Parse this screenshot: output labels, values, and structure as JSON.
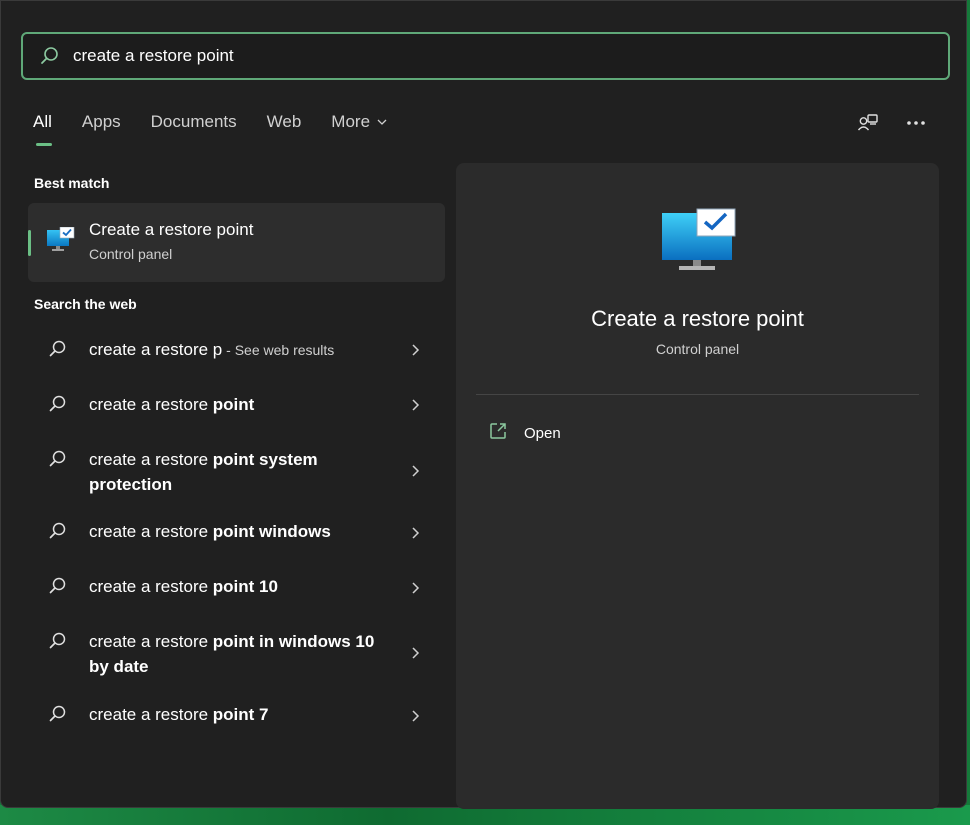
{
  "search": {
    "value": "create a restore point",
    "placeholder": ""
  },
  "tabs": [
    {
      "label": "All"
    },
    {
      "label": "Apps"
    },
    {
      "label": "Documents"
    },
    {
      "label": "Web"
    },
    {
      "label": "More"
    }
  ],
  "best_match": {
    "section": "Best match",
    "title_normal": "Create a restore p",
    "title_bold": "",
    "title": "Create a restore point",
    "subtitle": "Control panel",
    "icon": "monitor-check-icon"
  },
  "web": {
    "section": "Search the web",
    "items": [
      {
        "normal": "create a restore p",
        "bold": "",
        "hint": " - See web results"
      },
      {
        "normal": "create a restore ",
        "bold": "point",
        "hint": ""
      },
      {
        "normal": "create a restore ",
        "bold": "point system protection",
        "hint": ""
      },
      {
        "normal": "create a restore ",
        "bold": "point windows",
        "hint": ""
      },
      {
        "normal": "create a restore ",
        "bold": "point 10",
        "hint": ""
      },
      {
        "normal": "create a restore ",
        "bold": "point in windows 10 by date",
        "hint": ""
      },
      {
        "normal": "create a restore ",
        "bold": "point 7",
        "hint": ""
      }
    ]
  },
  "preview": {
    "title": "Create a restore point",
    "subtitle": "Control panel",
    "actions": [
      {
        "label": "Open",
        "icon": "open-external-icon"
      }
    ]
  },
  "colors": {
    "accent": "#6bbf85",
    "panel": "#2b2b2b",
    "background": "#202020"
  }
}
